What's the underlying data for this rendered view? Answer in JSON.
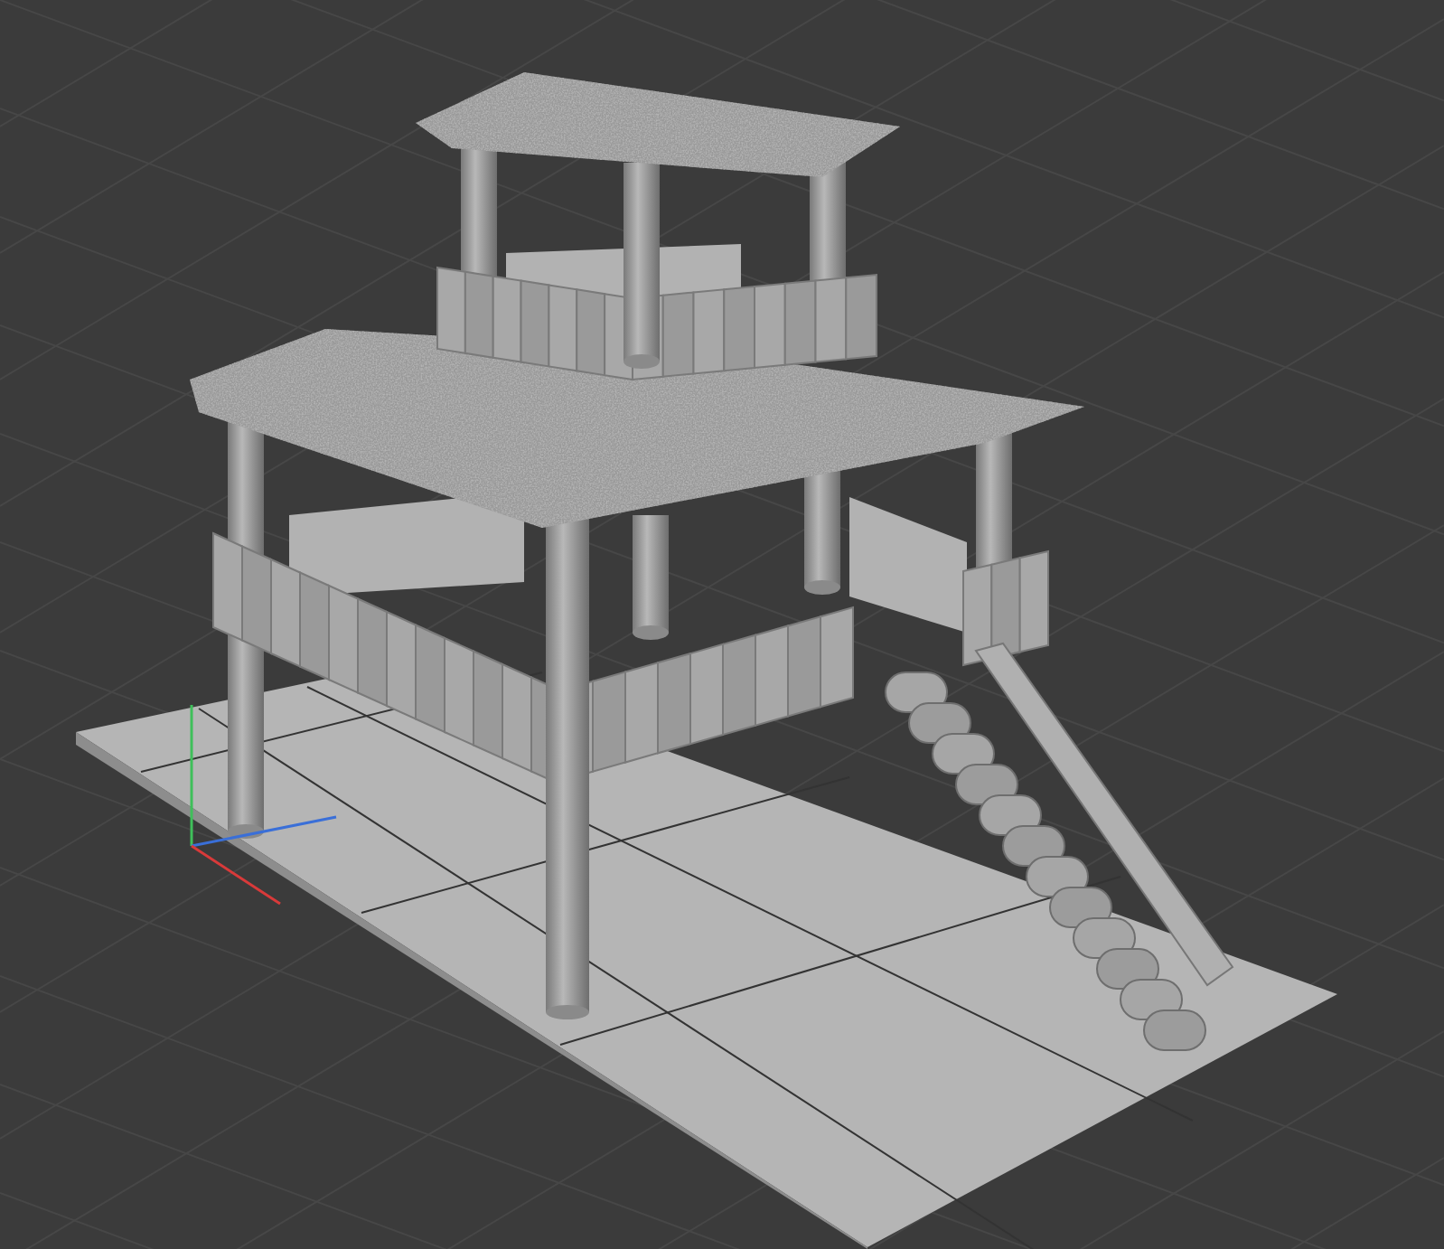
{
  "viewport": {
    "grid": true,
    "axes_gizmo": true
  }
}
